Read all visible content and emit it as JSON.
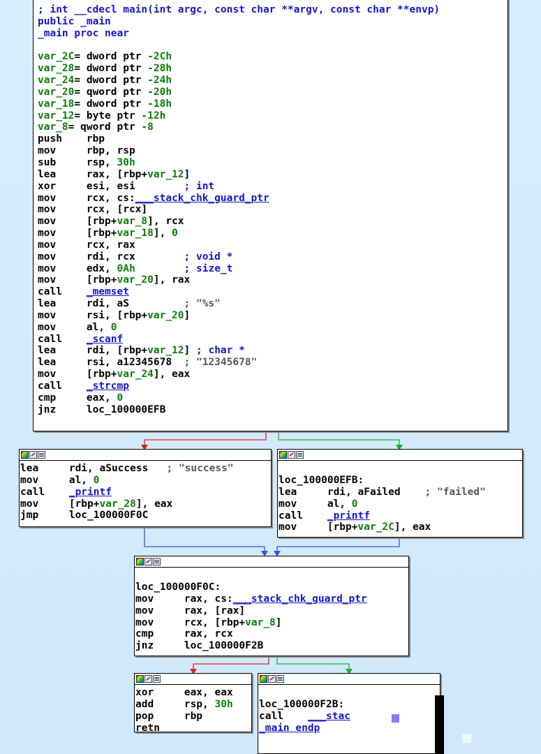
{
  "main_block": {
    "signature": "; int __cdecl main(int argc, const char **argv, const char **envp)",
    "public": "public",
    "public_sym": "_main",
    "proc_sym": "_main",
    "proc": "proc near",
    "vars": [
      {
        "name": "var_2C",
        "type": "= dword ptr",
        "off": "-2Ch"
      },
      {
        "name": "var_28",
        "type": "= dword ptr",
        "off": "-28h"
      },
      {
        "name": "var_24",
        "type": "= dword ptr",
        "off": "-24h"
      },
      {
        "name": "var_20",
        "type": "= qword ptr",
        "off": "-20h"
      },
      {
        "name": "var_18",
        "type": "= dword ptr",
        "off": "-18h"
      },
      {
        "name": "var_12",
        "type": "= byte ptr",
        "off": "-12h"
      },
      {
        "name": "var_8",
        "type": "= qword ptr",
        "off": "-8"
      }
    ],
    "lines": [
      "push    rbp",
      "mov     rbp, rsp",
      "sub     rsp, 30h",
      "lea     rax, [rbp+var_12]",
      "xor     esi, esi        ; int",
      "mov     rcx, cs:___stack_chk_guard_ptr",
      "mov     rcx, [rcx]",
      "mov     [rbp+var_8], rcx",
      "mov     [rbp+var_18], 0",
      "mov     rcx, rax",
      "mov     rdi, rcx        ; void *",
      "mov     edx, 0Ah        ; size_t",
      "mov     [rbp+var_20], rax",
      "call    _memset",
      "lea     rdi, aS         ; \"%s\"",
      "mov     rsi, [rbp+var_20]",
      "mov     al, 0",
      "call    _scanf",
      "lea     rdi, [rbp+var_12] ; char *",
      "lea     rsi, a12345678  ; \"12345678\"",
      "mov     [rbp+var_24], eax",
      "call    _strcmp",
      "cmp     eax, 0",
      "jnz     loc_100000EFB"
    ]
  },
  "success_block": {
    "lines": [
      "lea     rdi, aSuccess   ; \"success\"",
      "mov     al, 0",
      "call    _printf",
      "mov     [rbp+var_28], eax",
      "jmp     loc_100000F0C"
    ]
  },
  "failed_block": {
    "label": "loc_100000EFB:",
    "lines": [
      "lea     rdi, aFailed    ; \"failed\"",
      "mov     al, 0",
      "call    _printf",
      "mov     [rbp+var_2C], eax"
    ]
  },
  "check_block": {
    "label": "loc_100000F0C:",
    "lines": [
      "mov     rax, cs:___stack_chk_guard_ptr",
      "mov     rax, [rax]",
      "mov     rcx, [rbp+var_8]",
      "cmp     rax, rcx",
      "jnz     loc_100000F2B"
    ]
  },
  "return_block": {
    "lines": [
      "xor     eax, eax",
      "add     rsp, 30h",
      "pop     rbp",
      "retn"
    ]
  },
  "fail_stack_block": {
    "label": "loc_100000F2B:",
    "call_line": "call    ___stac",
    "endp": "_main endp"
  },
  "colors": {
    "edge_true": "#22aa22",
    "edge_false": "#dd2222",
    "edge_uncond": "#3355dd",
    "background": "#d6ecff"
  }
}
